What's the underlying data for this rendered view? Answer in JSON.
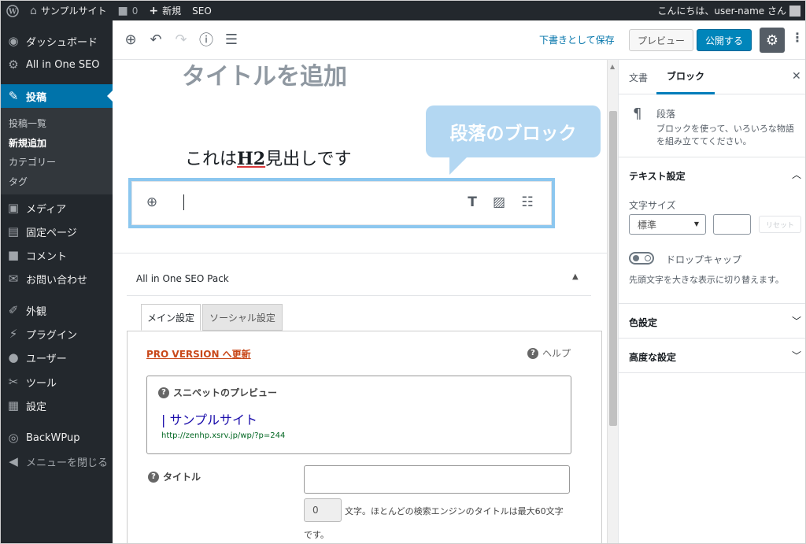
{
  "adminbar": {
    "site_name": "サンプルサイト",
    "comments_count": "0",
    "new_label": "新規",
    "seo_label": "SEO",
    "greeting": "こんにちは、user-name さん"
  },
  "sidebar": {
    "items": [
      {
        "label": "ダッシュボード",
        "icon": "dashboard-icon"
      },
      {
        "label": "All in One SEO",
        "icon": "gear-icon"
      },
      {
        "label": "投稿",
        "icon": "pushpin-icon"
      },
      {
        "label": "メディア",
        "icon": "media-icon"
      },
      {
        "label": "固定ページ",
        "icon": "page-icon"
      },
      {
        "label": "コメント",
        "icon": "comment-icon"
      },
      {
        "label": "お問い合わせ",
        "icon": "mail-icon"
      },
      {
        "label": "外観",
        "icon": "brush-icon"
      },
      {
        "label": "プラグイン",
        "icon": "plugin-icon"
      },
      {
        "label": "ユーザー",
        "icon": "user-icon"
      },
      {
        "label": "ツール",
        "icon": "wrench-icon"
      },
      {
        "label": "設定",
        "icon": "settings-icon"
      },
      {
        "label": "BackWPup",
        "icon": "backwpup-icon"
      },
      {
        "label": "メニューを閉じる",
        "icon": "collapse-icon"
      }
    ],
    "submenu": [
      "投稿一覧",
      "新規追加",
      "カテゴリー",
      "タグ"
    ]
  },
  "toolbar": {
    "save_draft": "下書きとして保存",
    "preview": "プレビュー",
    "publish": "公開する"
  },
  "editor": {
    "title": "タイトルを追加",
    "heading_pre": "これは",
    "heading_bold": "H2",
    "heading_post": "見出しです",
    "callout": "段落のブロック"
  },
  "seo": {
    "box_title": "All in One SEO Pack",
    "tab_main": "メイン設定",
    "tab_social": "ソーシャル設定",
    "pro_link": "PRO VERSION へ更新",
    "help": "ヘルプ",
    "snippet_heading": "スニペットのプレビュー",
    "snippet_title": "| サンプルサイト",
    "snippet_url": "http://zenhp.xsrv.jp/wp/?p=244",
    "title_label": "タイトル",
    "count_value": "0",
    "count_text": "文字。ほとんどの検索エンジンのタイトルは最大60文字",
    "count_text2": "です。"
  },
  "settings": {
    "tab_document": "文書",
    "tab_block": "ブロック",
    "block_name": "段落",
    "block_desc": "ブロックを使って、いろいろな物語を組み立ててください。",
    "text_settings": "テキスト設定",
    "font_size_label": "文字サイズ",
    "font_size_value": "標準",
    "reset": "リセット",
    "dropcap_label": "ドロップキャップ",
    "dropcap_help": "先頭文字を大きな表示に切り替えます。",
    "color_settings": "色設定",
    "advanced": "高度な設定"
  }
}
